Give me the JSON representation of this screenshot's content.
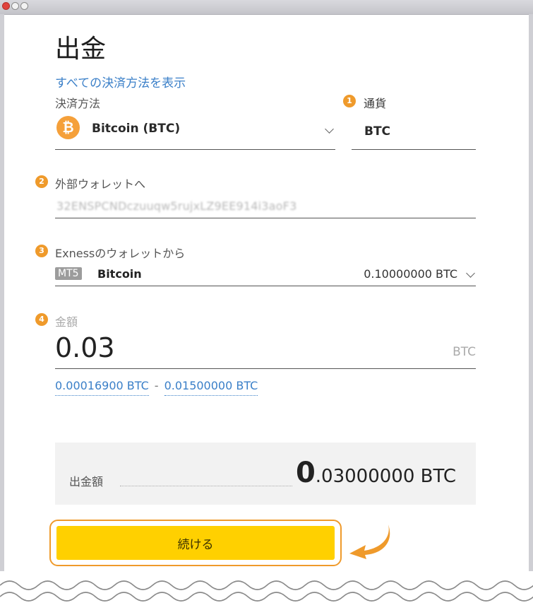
{
  "page": {
    "title": "出金"
  },
  "payment": {
    "show_all_link": "すべての決済方法を表示",
    "method_label": "決済方法",
    "method_name": "Bitcoin (BTC)",
    "currency_label": "通貨",
    "currency_value": "BTC"
  },
  "wallet": {
    "label": "外部ウォレットへ",
    "address": "32ENSPCNDczuuqw5rujxLZ9EE914i3aoF3"
  },
  "source": {
    "label": "Exnessのウォレットから",
    "platform_tag": "MT5",
    "account_name": "Bitcoin",
    "balance": "0.10000000 BTC"
  },
  "amount": {
    "label": "金額",
    "value": "0.03",
    "currency": "BTC",
    "range_min": "0.00016900 BTC",
    "range_sep": "-",
    "range_max": "0.01500000 BTC"
  },
  "summary": {
    "label": "出金額",
    "value_int": "0",
    "value_rest": ".03000000 BTC"
  },
  "actions": {
    "continue_label": "続ける"
  },
  "badges": {
    "one": "1",
    "two": "2",
    "three": "3",
    "four": "4"
  },
  "colors": {
    "accent_orange": "#ef9a2b",
    "button_yellow": "#ffd000",
    "link_blue": "#3a7fc8"
  },
  "icons": {
    "currency": "bitcoin-icon",
    "dropdown": "chevron-down-icon",
    "pointer": "curved-arrow-icon"
  }
}
